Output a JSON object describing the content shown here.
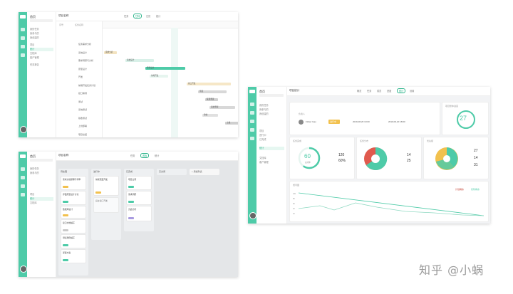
{
  "gantt": {
    "title": "项目名称",
    "tabs": [
      "任务",
      "甘特",
      "日历",
      "统计"
    ],
    "active_tab": "甘特",
    "sidebar": {
      "title": "首页",
      "items": [
        "我的任务",
        "我参与的",
        "我创建的",
        "项目",
        "统计",
        "文档库",
        "客户管理",
        "任务报告"
      ]
    },
    "table_header": [
      "序号",
      "任务名称"
    ],
    "rows": [
      "任务需求分析",
      "系统设计",
      "需求调研与分析",
      "原型设计",
      "开发",
      "前端开发任务计划",
      "接口联调",
      "测试",
      "系统测试",
      "验收测试",
      "上线部署",
      "项目总结"
    ],
    "bars": [
      "需求分析",
      "系统设计",
      "原型设计",
      "前端开发",
      "接口开发",
      "测试",
      "联调测试",
      "系统测试",
      "验收",
      "上线"
    ]
  },
  "kanban": {
    "title": "项目名称",
    "tabs": [
      "任务",
      "看板",
      "统计"
    ],
    "active_tab": "看板",
    "sidebar": {
      "title": "首页",
      "items": [
        "我的任务",
        "我参与的",
        "项目",
        "统计",
        "文档库"
      ]
    },
    "columns": [
      {
        "title": "待处理",
        "cards": [
          "需求文档整理与评审",
          "界面原型设计讨论",
          "数据库设计",
          "接口文档编写",
          "测试用例编写",
          "部署方案"
        ]
      },
      {
        "title": "进行中",
        "cards": [
          "前端页面开发",
          "后台接口开发"
        ]
      },
      {
        "title": "已完成",
        "cards": [
          "项目立项",
          "需求调研",
          "竞品分析"
        ]
      },
      {
        "title": "已关闭",
        "cards": []
      }
    ],
    "add_column": "+ 添加列表"
  },
  "stats": {
    "title": "项目统计",
    "tabs": [
      "概览",
      "任务",
      "成员",
      "进度",
      "统计",
      "设置"
    ],
    "active_tab": "统计",
    "sidebar": {
      "title": "首页",
      "items": [
        "我的任务",
        "我参与的",
        "我创建的",
        "项目",
        "进行中",
        "已完成",
        "统计",
        "文档库",
        "客户管理"
      ]
    },
    "member_label": "负责人",
    "member_name": "Fisher Gao",
    "status_badge": "进行中",
    "start_date": "2019-08-20 10:00",
    "end_date": "2019-09-20 18:00",
    "progress_label": "项目整体进度",
    "progress_value": "27",
    "task_done_label": "任务完成",
    "ring_value": "60",
    "ring_sub": "完成率",
    "done_count": "120",
    "done_rate": "60%",
    "pie_label": "任务分布",
    "pie_values": [
      "14",
      "25"
    ],
    "priority_label": "优先级",
    "priority_values": [
      "27",
      "14",
      "31"
    ],
    "burndown_label": "燃尽图",
    "legend": [
      "计划剩余",
      "实际剩余"
    ],
    "y_ticks": [
      "100",
      "80",
      "60",
      "40",
      "20",
      "0"
    ]
  },
  "watermark": "知乎 @小蜗",
  "colors": {
    "accent": "#4ecba8",
    "red": "#e05a4e",
    "yellow": "#f2c14e",
    "gray": "#c9c9c9"
  }
}
